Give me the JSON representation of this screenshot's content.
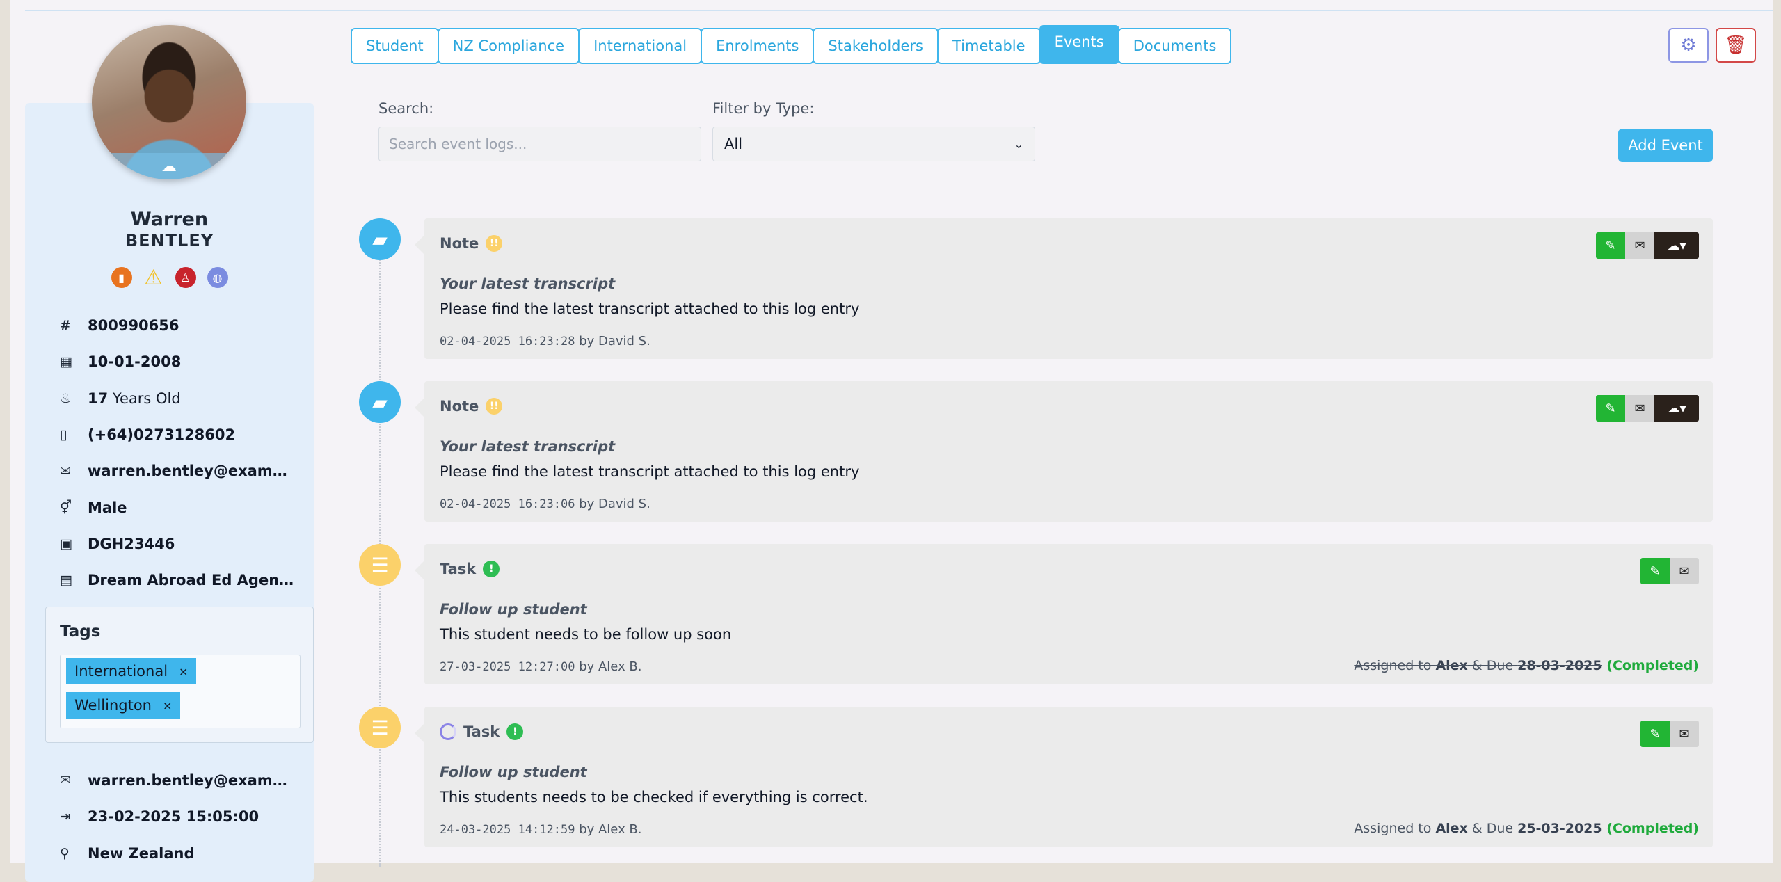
{
  "tabs": [
    "Student",
    "NZ Compliance",
    "International",
    "Enrolments",
    "Stakeholders",
    "Timetable",
    "Events",
    "Documents"
  ],
  "active_tab": "Events",
  "profile": {
    "first_name": "Warren",
    "last_name": "BENTLEY",
    "id_number": "800990656",
    "dob": "10-01-2008",
    "age_num": "17",
    "age_text": " Years Old",
    "phone": "(+64)0273128602",
    "email": "warren.bentley@example....",
    "gender": "Male",
    "passport": "DGH23446",
    "agency": "Dream Abroad Ed Agency",
    "email2": "warren.bentley@example....",
    "arrival": "23-02-2025 15:05:00",
    "country": "New Zealand"
  },
  "tags": {
    "title": "Tags",
    "items": [
      "International",
      "Wellington"
    ]
  },
  "filters": {
    "search_label": "Search:",
    "search_placeholder": "Search event logs...",
    "type_label": "Filter by Type:",
    "type_value": "All",
    "add_button": "Add Event"
  },
  "events": [
    {
      "type": "Note",
      "priority": "!!",
      "title": "Your latest transcript",
      "body": "Please find the latest transcript attached to this log entry",
      "timestamp": "02-04-2025 16:23:28",
      "author": " by David S."
    },
    {
      "type": "Note",
      "priority": "!!",
      "title": "Your latest transcript",
      "body": "Please find the latest transcript attached to this log entry",
      "timestamp": "02-04-2025 16:23:06",
      "author": " by David S."
    },
    {
      "type": "Task",
      "priority": "!",
      "title": "Follow up student",
      "body": "This student needs to be follow up soon",
      "timestamp": "27-03-2025 12:27:00",
      "author": " by Alex B.",
      "assigned_prefix": "Assigned to ",
      "assignee": "Alex",
      "due_prefix": " & Due ",
      "due": "28-03-2025",
      "status": " (Completed)"
    },
    {
      "type": "Task",
      "priority": "!",
      "title": "Follow up student",
      "body": "This students needs to be checked if everything is correct.",
      "timestamp": "24-03-2025 14:12:59",
      "author": " by Alex B.",
      "assigned_prefix": "Assigned to ",
      "assignee": "Alex",
      "due_prefix": " & Due ",
      "due": "25-03-2025",
      "status": " (Completed)"
    }
  ],
  "colors": {
    "accent": "#3fb6ec",
    "edit_green": "#22b534",
    "completed_green": "#1faa3c",
    "task_yellow": "#fbd16a",
    "delete_red": "#d34848"
  }
}
